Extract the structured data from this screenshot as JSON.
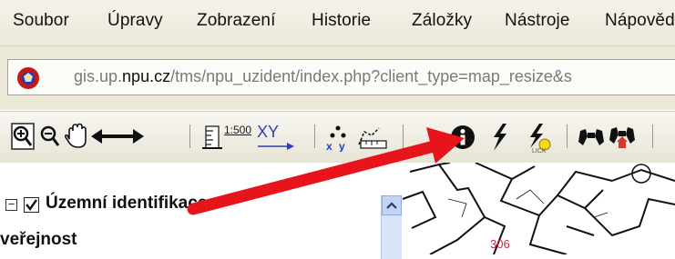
{
  "menu": {
    "items": [
      {
        "label": "Soubor",
        "name": "menu-soubor"
      },
      {
        "label": "Úpravy",
        "name": "menu-upravy"
      },
      {
        "label": "Zobrazení",
        "name": "menu-zobrazeni"
      },
      {
        "label": "Historie",
        "name": "menu-historie"
      },
      {
        "label": "Záložky",
        "name": "menu-zalozky"
      },
      {
        "label": "Nástroje",
        "name": "menu-nastroje"
      },
      {
        "label": "Nápověda",
        "name": "menu-napoveda"
      }
    ]
  },
  "address": {
    "url_prefix": "gis.up.",
    "url_domain": "npu.cz",
    "url_rest": "/tms/npu_uzident/index.php?client_type=map_resize&s"
  },
  "toolbar": {
    "scale_label": "1:500",
    "xy_label": "XY",
    "icons": [
      "zoom-in-icon",
      "zoom-out-icon",
      "pan-hand-icon",
      "extent-arrows-icon",
      "scale-icon",
      "xy-icon",
      "measure-point-icon",
      "measure-distance-icon",
      "info-icon",
      "lightning-icon",
      "lightning-link-icon",
      "binoculars-icon",
      "binoculars-home-icon"
    ]
  },
  "layer_tree": {
    "title_line1": "Územní identifikace -",
    "title_line2": "veřejnost",
    "checked": true
  },
  "map": {
    "label": "306"
  },
  "colors": {
    "arrow": "#e8141b",
    "toolbar_bg": "#ece9d8",
    "map_line": "#111111"
  }
}
